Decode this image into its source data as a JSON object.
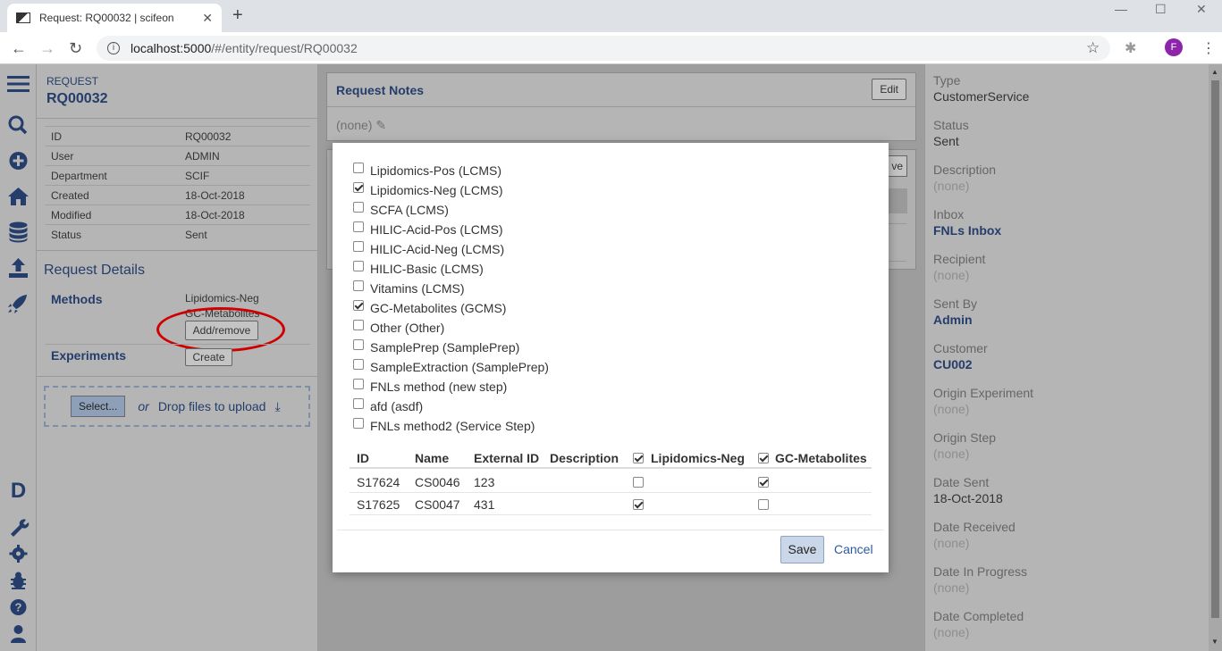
{
  "browser": {
    "tab_title": "Request: RQ00032 | scifeon",
    "tab_close": "✕",
    "new_tab": "+",
    "url_host": "localhost:5000",
    "url_path": "/#/entity/request/RQ00032",
    "profile_initial": "F",
    "icons": [
      "back-arrow-icon",
      "forward-arrow-icon",
      "reload-icon",
      "info-icon",
      "star-icon",
      "extension-icon",
      "menu-dots-icon"
    ]
  },
  "sidebar": {
    "icons": [
      "menu-icon",
      "search-icon",
      "plus-circle-icon",
      "home-icon",
      "database-icon",
      "upload-icon",
      "rocket-icon",
      "d-logo",
      "wrench-icon",
      "gear-icon",
      "bug-icon",
      "help-icon",
      "user-icon"
    ],
    "logo_letter": "D"
  },
  "request": {
    "label": "REQUEST",
    "id": "RQ00032",
    "fields": [
      {
        "key": "ID",
        "value": "RQ00032"
      },
      {
        "key": "User",
        "value": "ADMIN"
      },
      {
        "key": "Department",
        "value": "SCIF"
      },
      {
        "key": "Created",
        "value": "18-Oct-2018"
      },
      {
        "key": "Modified",
        "value": "18-Oct-2018"
      },
      {
        "key": "Status",
        "value": "Sent"
      }
    ],
    "details_title": "Request Details",
    "methods_label": "Methods",
    "methods": [
      "Lipidomics-Neg",
      "GC-Metabolites"
    ],
    "add_remove": "Add/remove",
    "experiments_label": "Experiments",
    "create": "Create",
    "upload": {
      "select": "Select...",
      "or": "or",
      "drop": "Drop files to upload"
    }
  },
  "notes": {
    "title": "Request Notes",
    "edit": "Edit",
    "value": "(none)",
    "partial_button": "ve"
  },
  "right_panel": [
    {
      "label": "Type",
      "value": "CustomerService",
      "style": "plain"
    },
    {
      "label": "Status",
      "value": "Sent",
      "style": "plain"
    },
    {
      "label": "Description",
      "value": "(none)",
      "style": "none"
    },
    {
      "label": "Inbox",
      "value": "FNLs Inbox",
      "style": "link"
    },
    {
      "label": "Recipient",
      "value": "(none)",
      "style": "none"
    },
    {
      "label": "Sent By",
      "value": "Admin",
      "style": "link"
    },
    {
      "label": "Customer",
      "value": "CU002",
      "style": "link"
    },
    {
      "label": "Origin Experiment",
      "value": "(none)",
      "style": "none"
    },
    {
      "label": "Origin Step",
      "value": "(none)",
      "style": "none"
    },
    {
      "label": "Date Sent",
      "value": "18-Oct-2018",
      "style": "plain"
    },
    {
      "label": "Date Received",
      "value": "(none)",
      "style": "none"
    },
    {
      "label": "Date In Progress",
      "value": "(none)",
      "style": "none"
    },
    {
      "label": "Date Completed",
      "value": "(none)",
      "style": "none"
    }
  ],
  "modal": {
    "options": [
      {
        "label": "Lipidomics-Pos (LCMS)",
        "checked": false
      },
      {
        "label": "Lipidomics-Neg (LCMS)",
        "checked": true
      },
      {
        "label": "SCFA (LCMS)",
        "checked": false
      },
      {
        "label": "HILIC-Acid-Pos (LCMS)",
        "checked": false
      },
      {
        "label": "HILIC-Acid-Neg (LCMS)",
        "checked": false
      },
      {
        "label": "HILIC-Basic (LCMS)",
        "checked": false
      },
      {
        "label": "Vitamins (LCMS)",
        "checked": false
      },
      {
        "label": "GC-Metabolites (GCMS)",
        "checked": true
      },
      {
        "label": "Other (Other)",
        "checked": false
      },
      {
        "label": "SamplePrep (SamplePrep)",
        "checked": false
      },
      {
        "label": "SampleExtraction (SamplePrep)",
        "checked": false
      },
      {
        "label": "FNLs method (new step)",
        "checked": false
      },
      {
        "label": "afd (asdf)",
        "checked": false
      },
      {
        "label": "FNLs method2 (Service Step)",
        "checked": false
      }
    ],
    "table": {
      "headers": [
        "ID",
        "Name",
        "External ID",
        "Description",
        "Lipidomics-Neg",
        "GC-Metabolites"
      ],
      "header_checks": [
        true,
        true
      ],
      "rows": [
        {
          "id": "S17624",
          "name": "CS0046",
          "external_id": "123",
          "description": "",
          "lipidomics_neg": false,
          "gc_metabolites": true
        },
        {
          "id": "S17625",
          "name": "CS0047",
          "external_id": "431",
          "description": "",
          "lipidomics_neg": true,
          "gc_metabolites": false
        }
      ]
    },
    "save": "Save",
    "cancel": "Cancel"
  }
}
